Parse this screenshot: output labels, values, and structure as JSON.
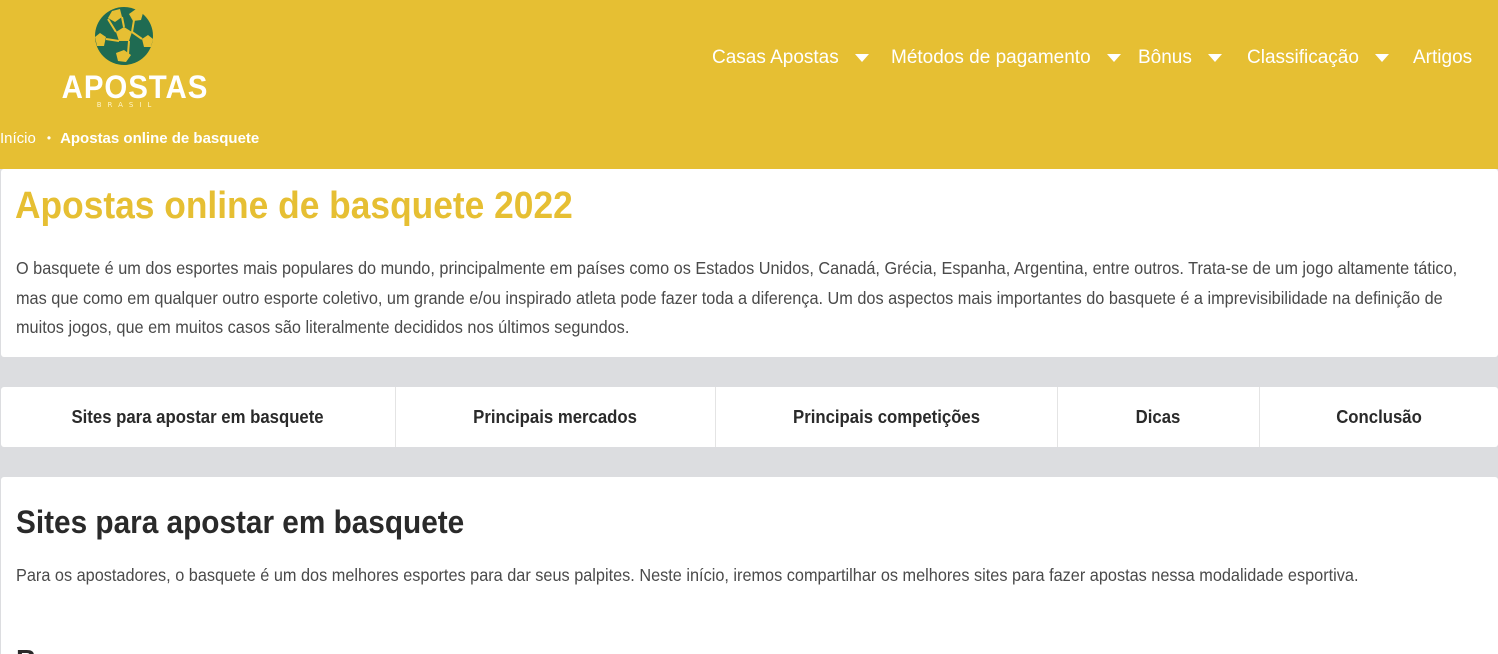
{
  "brand": {
    "logo_text": "APOSTAS",
    "logo_subtext": "BRASIL",
    "primary_color": "#e6bf33",
    "logo_ball_color": "#1f6b52"
  },
  "nav": {
    "items": [
      {
        "label": "Casas Apostas",
        "has_dropdown": true
      },
      {
        "label": "Métodos de pagamento",
        "has_dropdown": true
      },
      {
        "label": "Bônus",
        "has_dropdown": true
      },
      {
        "label": "Classificação",
        "has_dropdown": true
      },
      {
        "label": "Artigos",
        "has_dropdown": false
      }
    ]
  },
  "breadcrumb": {
    "home": "Início",
    "separator": "•",
    "current": "Apostas online de basquete"
  },
  "intro": {
    "title": "Apostas online de basquete 2022",
    "text": "O basquete é um dos esportes mais populares do mundo, principalmente em países como os Estados Unidos, Canadá, Grécia, Espanha, Argentina, entre outros. Trata-se de um jogo altamente tático, mas que como em qualquer outro esporte coletivo, um grande e/ou inspirado atleta pode fazer toda a diferença. Um dos aspectos mais importantes do basquete é a imprevisibilidade na definição de muitos jogos, que em muitos casos são literalmente decididos nos últimos segundos."
  },
  "tabs": [
    {
      "label": "Sites para apostar em basquete"
    },
    {
      "label": "Principais mercados"
    },
    {
      "label": "Principais competições"
    },
    {
      "label": "Dicas"
    },
    {
      "label": "Conclusão"
    }
  ],
  "section": {
    "title": "Sites para apostar em basquete",
    "text": "Para os apostadores, o basquete é um dos melhores esportes para dar seus palpites. Neste início, iremos compartilhar os melhores sites para fazer apostas nessa modalidade esportiva.",
    "next_heading_partial": "B"
  }
}
